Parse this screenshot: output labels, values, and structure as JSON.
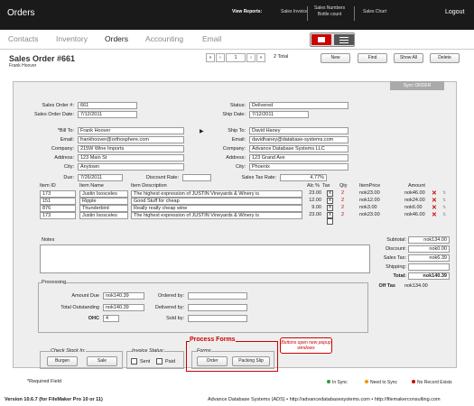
{
  "app": {
    "title": "Orders"
  },
  "topbar": {
    "view_reports": "View Reports:",
    "sales_invoice": "Sales Invoice",
    "sales_numbers_1": "Sales Numbers",
    "sales_numbers_2": "Bottle count",
    "sales_chart": "Sales Chart",
    "logout": "Logout"
  },
  "nav": {
    "contacts": "Contacts",
    "inventory": "Inventory",
    "orders": "Orders",
    "accounting": "Accounting",
    "email": "Email"
  },
  "header": {
    "title": "Sales Order #661",
    "customer": "Frank Hoover",
    "record": "1",
    "total": "2  Total",
    "new": "New",
    "find": "Find",
    "show_all": "Show All",
    "delete": "Delete",
    "sync": "Sync ORDER"
  },
  "order": {
    "num_label": "Sales Order #:",
    "num": "661",
    "date_label": "Sales Order Date:",
    "date": "7/12/2011",
    "status_label": "Status:",
    "status": "Delivered",
    "ship_date_label": "Ship Date:",
    "ship_date": "7/12/2011"
  },
  "bill": {
    "label": "*Bill To:",
    "name": "Frank Hoover",
    "email_label": "Email:",
    "email": "frankhoover@orthosphere.com",
    "company_label": "Company:",
    "company": "215W Wine Imports",
    "address_label": "Address:",
    "address": "123 Main St",
    "city_label": "City:",
    "city": "Anytown"
  },
  "ship": {
    "label": "Ship To:",
    "name": "David Haney",
    "email_label": "Email:",
    "email": "davidhaney@database-systems.com",
    "company_label": "Company:",
    "company": "Advance Database Systems LLC",
    "address_label": "Address:",
    "address": "123 Grand Ave",
    "city_label": "City:",
    "city": "Phoenix"
  },
  "terms": {
    "due_label": "Due:",
    "due": "7/26/2011",
    "discount_label": "Discount Rate:",
    "discount": "",
    "tax_label": "Sales Tax Rate:",
    "tax": "4.77%"
  },
  "items": {
    "headers": {
      "id": "Item ID",
      "name": "Item Name",
      "desc": "Item Description",
      "alc": "Alc %",
      "tax": "Tax",
      "qty": "Qty",
      "price": "ItemPrice",
      "amount": "Amount"
    },
    "rows": [
      {
        "id": "173",
        "name": "Justin Isosceles",
        "desc": "The highest expression of JUSTIN Vineyards & Winery is",
        "alc": "23.00",
        "tax": "x",
        "qty": "2",
        "price": "nok23.00",
        "amount": "nok46.00"
      },
      {
        "id": "151",
        "name": "Ripple",
        "desc": "Good Stuff for cheap",
        "alc": "12.00",
        "tax": "x",
        "qty": "2",
        "price": "nok12.00",
        "amount": "nok24.00"
      },
      {
        "id": "876",
        "name": "Thunderbird",
        "desc": "Really really cheap wine",
        "alc": "9.00",
        "tax": "x",
        "qty": "2",
        "price": "nok3.00",
        "amount": "nok6.00"
      },
      {
        "id": "173",
        "name": "Justin Isosceles",
        "desc": "The highest expression of JUSTIN Vineyards & Winery is",
        "alc": "23.00",
        "tax": "x",
        "qty": "2",
        "price": "nok23.00",
        "amount": "nok46.00"
      }
    ]
  },
  "notes": {
    "label": "Notes"
  },
  "totals": {
    "subtotal_label": "Subtotal:",
    "subtotal": "nok134.00",
    "discount_label": "Discount:",
    "discount": "nok0.00",
    "tax_label": "Sales Tax:",
    "tax": "nok6.39",
    "shipping_label": "Shipping:",
    "shipping": "",
    "total_label": "Total:",
    "total": "nok140.39",
    "off_tax_label": "Off Tax",
    "off_tax": "nok134.00"
  },
  "processing": {
    "label": "Processing",
    "amount_due_label": "Amount Due",
    "amount_due": "nok140.39",
    "outstanding_label": "Total Outstanding",
    "outstanding": "nok140.39",
    "ohc_label": "OHC",
    "ohc": "4",
    "ordered_label": "Ordered by:",
    "delivered_label": "Delivered by:",
    "sold_label": "Sold by:"
  },
  "stock": {
    "label": "Check Stock In:",
    "burgen": "Burgen",
    "sale": "Sale"
  },
  "invoice": {
    "label": "Invoice Status:",
    "sent": "Sent",
    "paid": "Paid"
  },
  "forms": {
    "title": "Process Forms",
    "label": "Forms",
    "order": "Order",
    "packing": "Packing Slip",
    "note": "Buttons open new popup windows"
  },
  "required": "*Required Field",
  "legend": {
    "in_sync": "In Sync",
    "need_sync": "Need to Sync",
    "no_record": "No Record Exists"
  },
  "footer": {
    "version": "Version 10.6.7 (for FileMaker Pro 10 or 11)",
    "company": "Advance Database Systems (ADS) • http://advancedatabasesystems.com • http://filemakerconsulting.com"
  },
  "colors": {
    "accent": "#cc0000",
    "topbar": "#1a1a1a",
    "panel": "#eeeeee"
  }
}
